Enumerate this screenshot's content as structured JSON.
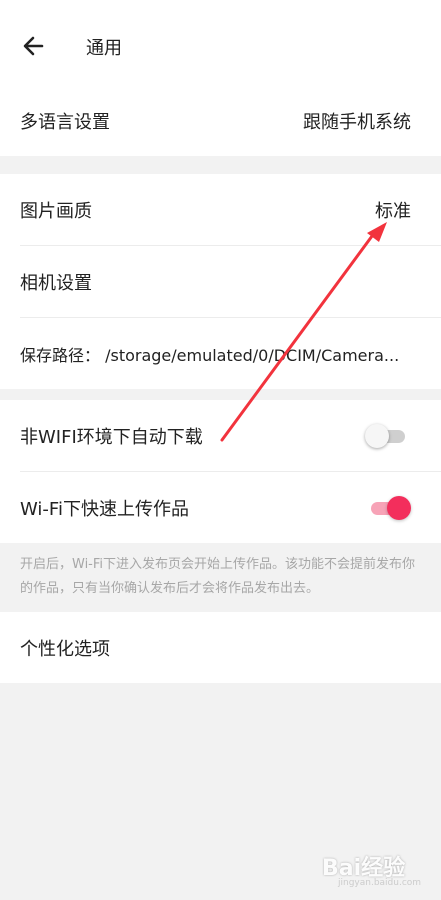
{
  "header": {
    "title": "通用",
    "back_icon": "back-arrow-icon"
  },
  "language": {
    "label": "多语言设置",
    "value": "跟随手机系统"
  },
  "media": {
    "image_quality_label": "图片画质",
    "image_quality_value": "标准",
    "camera_label": "相机设置",
    "save_path_label": "保存路径： /storage/emulated/0/DCIM/Camera..."
  },
  "network": {
    "non_wifi_download_label": "非WIFI环境下自动下载",
    "non_wifi_download_on": false,
    "wifi_fast_upload_label": "Wi-Fi下快速上传作品",
    "wifi_fast_upload_on": true,
    "description": "开启后，Wi-Fi下进入发布页会开始上传作品。该功能不会提前发布你的作品，只有当你确认发布后才会将作品发布出去。"
  },
  "personalization": {
    "label": "个性化选项"
  },
  "watermark": {
    "text": "Bai经验",
    "url": "jingyan.baidu.com"
  },
  "colors": {
    "accent": "#f32e5c",
    "annotation_arrow": "#f2333d",
    "background": "#f2f2f2"
  }
}
